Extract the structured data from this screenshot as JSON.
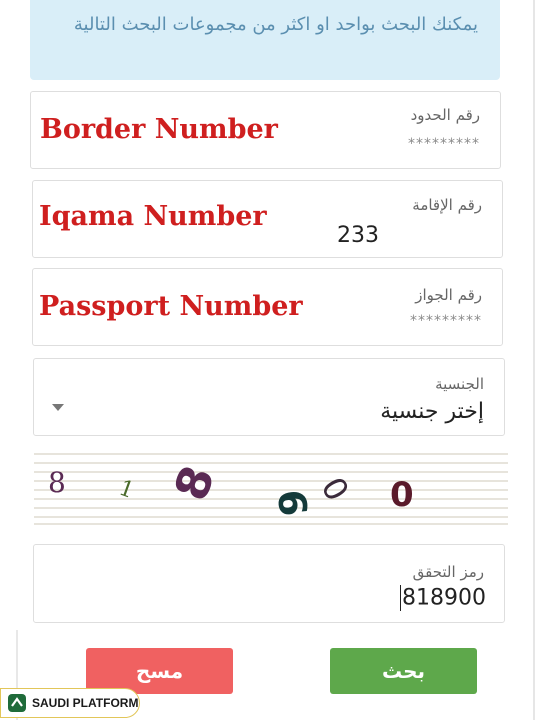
{
  "info_text": "يمكنك البحث بواحد او اكثر من مجموعات البحث التالية",
  "fields": {
    "border": {
      "label": "رقم الحدود",
      "value": "*********",
      "overlay": "Border Number"
    },
    "iqama": {
      "label": "رقم الإقامة",
      "value": "233",
      "overlay": "Iqama Number"
    },
    "passport": {
      "label": "رقم الجواز",
      "value": "*********",
      "overlay": "Passport Number"
    }
  },
  "nationality": {
    "label": "الجنسية",
    "selected": "إختر جنسية"
  },
  "captcha": {
    "digits": [
      "8",
      "1",
      "8",
      "9",
      "0",
      "0"
    ]
  },
  "verification": {
    "label": "رمز التحقق",
    "value": "818900"
  },
  "buttons": {
    "search": "بحث",
    "clear": "مسح"
  },
  "colors": {
    "search": "#5ea84b",
    "clear": "#f06161",
    "info_bg": "#d9eef8",
    "overlay": "#cf1f1f"
  },
  "watermark": "SAUDI PLATFORM"
}
